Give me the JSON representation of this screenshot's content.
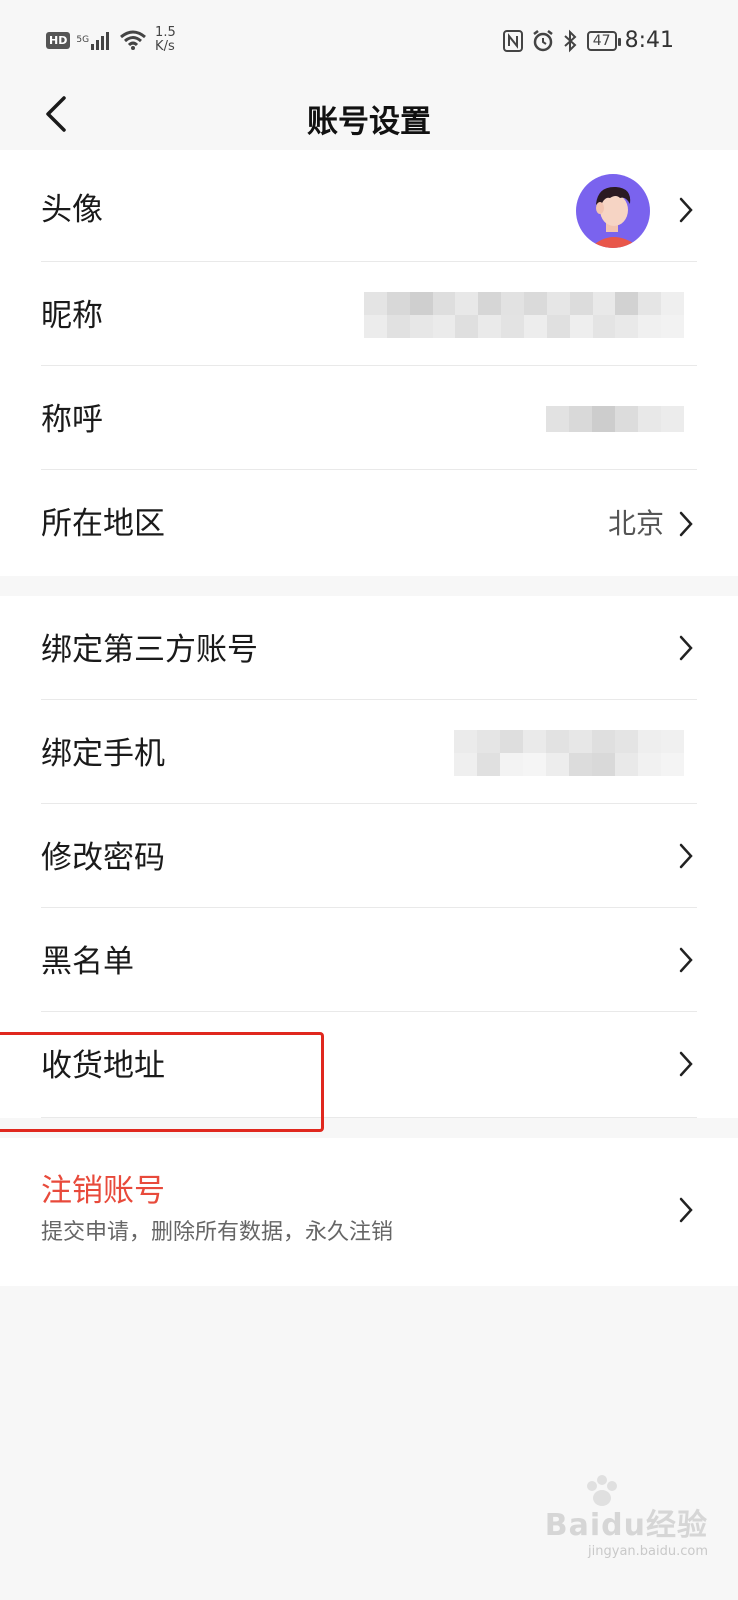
{
  "status_bar": {
    "hd": "HD",
    "net": "5G",
    "speed_value": "1.5",
    "speed_unit": "K/s",
    "battery": "47",
    "time": "8:41",
    "icons": [
      "signal-icon",
      "wifi-icon",
      "nfc-icon",
      "alarm-icon",
      "bluetooth-icon",
      "battery-icon"
    ]
  },
  "nav": {
    "title": "账号设置",
    "back_icon": "back-arrow-icon"
  },
  "profile": {
    "avatar_label": "头像",
    "nickname_label": "昵称",
    "title_label": "称呼",
    "region_label": "所在地区",
    "region_value": "北京"
  },
  "security": {
    "bind_third_party_label": "绑定第三方账号",
    "bind_phone_label": "绑定手机",
    "change_password_label": "修改密码",
    "blacklist_label": "黑名单",
    "address_label": "收货地址"
  },
  "deactivate": {
    "title": "注销账号",
    "description": "提交申请，删除所有数据，永久注销"
  },
  "watermark": {
    "main": "Baidu经验",
    "sub": "jingyan.baidu.com"
  },
  "colors": {
    "danger": "#e84a3b",
    "highlight_box": "#e0281e",
    "avatar_bg": "#7a63ee"
  }
}
